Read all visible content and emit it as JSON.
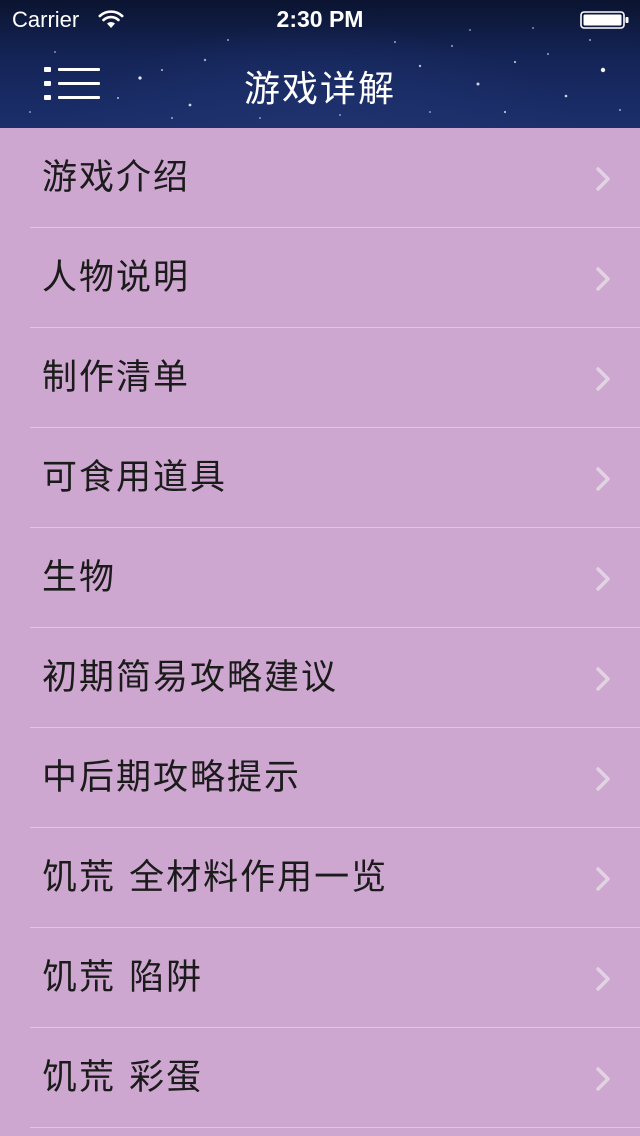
{
  "status_bar": {
    "carrier": "Carrier",
    "time": "2:30 PM"
  },
  "nav": {
    "title": "游戏详解",
    "menu_icon": "list-menu-icon"
  },
  "list": {
    "chevron_icon": "chevron-right-icon",
    "items": [
      {
        "label": "游戏介绍"
      },
      {
        "label": "人物说明"
      },
      {
        "label": "制作清单"
      },
      {
        "label": "可食用道具"
      },
      {
        "label": "生物"
      },
      {
        "label": "初期简易攻略建议"
      },
      {
        "label": "中后期攻略提示"
      },
      {
        "label": "饥荒 全材料作用一览"
      },
      {
        "label": "饥荒 陷阱"
      },
      {
        "label": "饥荒 彩蛋"
      }
    ]
  },
  "colors": {
    "list_background": "#cda7cf",
    "separator": "#ddc9de",
    "header_dark": "#0b1430",
    "header_light": "#1c2f6c",
    "text": "#1b1b1b",
    "chevron": "#e2d3e3"
  }
}
